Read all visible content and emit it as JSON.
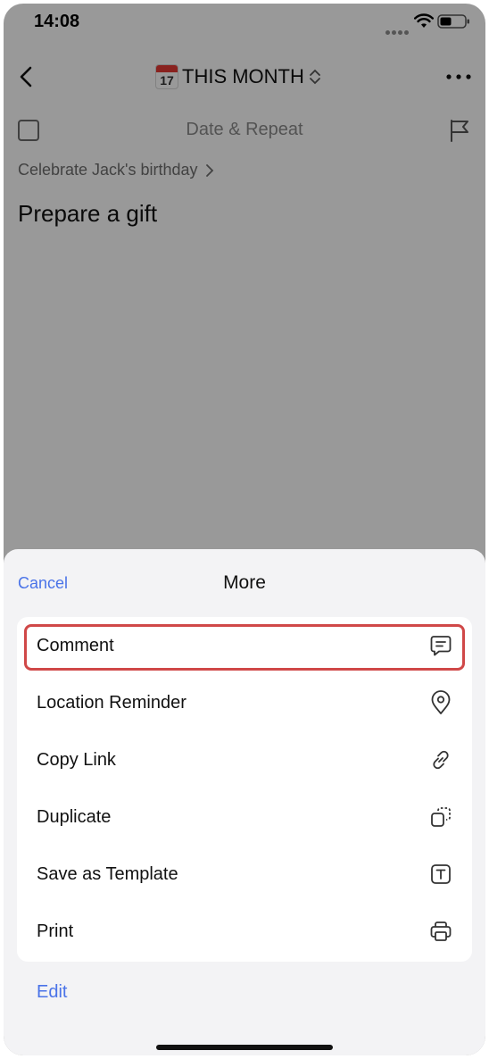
{
  "status_bar": {
    "time": "14:08"
  },
  "nav": {
    "calendar_day": "17",
    "title": "THIS MONTH"
  },
  "task": {
    "date_repeat_placeholder": "Date & Repeat",
    "parent_task": "Celebrate Jack's birthday",
    "title": "Prepare a gift"
  },
  "sheet": {
    "cancel_label": "Cancel",
    "title": "More",
    "items": [
      {
        "label": "Comment",
        "icon": "comment-icon"
      },
      {
        "label": "Location Reminder",
        "icon": "location-pin-icon"
      },
      {
        "label": "Copy Link",
        "icon": "link-icon"
      },
      {
        "label": "Duplicate",
        "icon": "duplicate-icon"
      },
      {
        "label": "Save as Template",
        "icon": "template-icon"
      },
      {
        "label": "Print",
        "icon": "printer-icon"
      }
    ],
    "edit_label": "Edit"
  },
  "colors": {
    "accent": "#4a73e8",
    "highlight_border": "#d04848",
    "sheet_background": "#f3f3f5",
    "overlay": "rgba(0,0,0,0.40)"
  }
}
